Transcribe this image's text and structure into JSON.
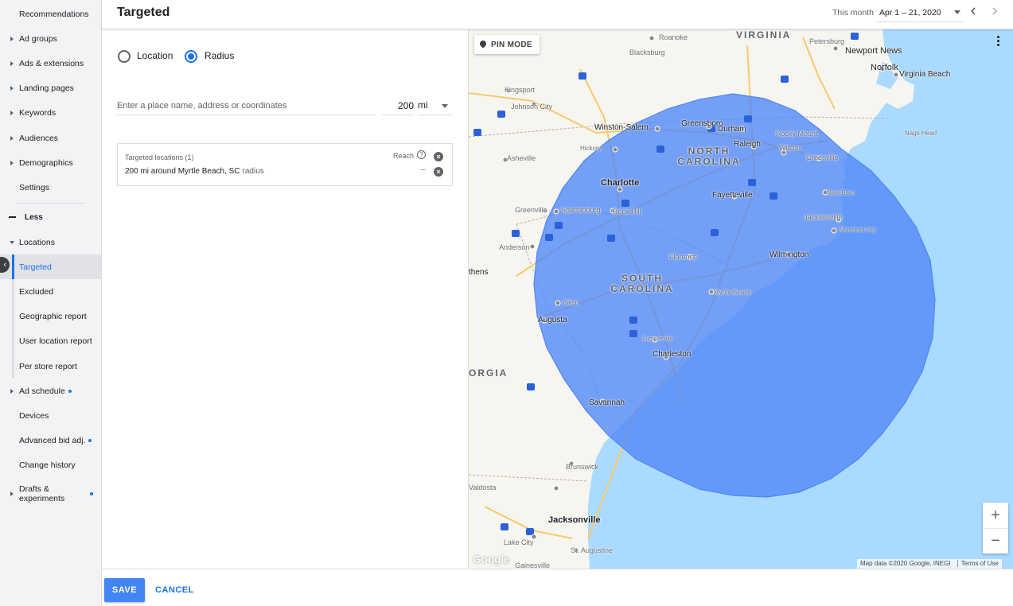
{
  "sidebar": {
    "items": [
      {
        "label": "Recommendations"
      },
      {
        "label": "Ad groups"
      },
      {
        "label": "Ads & extensions"
      },
      {
        "label": "Landing pages"
      },
      {
        "label": "Keywords"
      },
      {
        "label": "Audiences"
      },
      {
        "label": "Demographics"
      },
      {
        "label": "Settings"
      }
    ],
    "less_label": "Less",
    "locations_label": "Locations",
    "sub_items": [
      {
        "label": "Targeted",
        "active": true
      },
      {
        "label": "Excluded"
      },
      {
        "label": "Geographic report"
      },
      {
        "label": "User location report"
      },
      {
        "label": "Per store report"
      }
    ],
    "more_items": [
      {
        "label": "Ad schedule",
        "has_dot": true
      },
      {
        "label": "Devices"
      },
      {
        "label": "Advanced bid adj.",
        "has_dot": true
      },
      {
        "label": "Change history"
      },
      {
        "label": "Drafts & experiments",
        "line1": "Drafts &",
        "line2": "experiments",
        "has_dot": true
      }
    ]
  },
  "header": {
    "title": "Targeted",
    "date_range_label": "This month",
    "date_range_value": "Apr 1 – 21, 2020"
  },
  "panel": {
    "radio_location_label": "Location",
    "radio_radius_label": "Radius",
    "selected_mode": "Radius",
    "search_placeholder": "Enter a place name, address or coordinates",
    "radius_value": "200",
    "radius_unit": "mi",
    "targets": {
      "header": "Targeted locations (1)",
      "reach_label": "Reach",
      "help_glyph": "?",
      "row_text": "200 mi around Myrtle Beach, SC",
      "row_tag": "radius",
      "row_reach": "–"
    }
  },
  "map": {
    "pin_mode_label": "PIN MODE",
    "zoom_in": "+",
    "zoom_out": "−",
    "attribution": "Map data ©2020 Google, INEGI",
    "terms": "Terms of Use",
    "logo": "Google",
    "circle_color": "#4f86f7",
    "water_color": "#aadaff",
    "land_color": "#f7f5ef",
    "labels": {
      "virginia": "VIRGINIA",
      "north_carolina_1": "NORTH",
      "north_carolina_2": "CAROLINA",
      "south_carolina_1": "SOUTH",
      "south_carolina_2": "CAROLINA",
      "georgia": "ORGIA",
      "roanoke": "Roanoke",
      "blacksburg": "Blacksburg",
      "petersburg": "Petersburg",
      "newport_news": "Newport News",
      "norfolk": "Norfolk",
      "virginia_beach": "Virginia Beach",
      "kingsport": "Kingsport",
      "johnson_city": "Johnson City",
      "winston_salem": "Winston-Salem",
      "greensboro": "Greensboro",
      "durham": "Durham",
      "rocky_mount": "Rocky Mount",
      "nags_head": "Nags Head",
      "hickory": "Hickory",
      "raleigh": "Raleigh",
      "wilson": "Wilson",
      "asheville": "Asheville",
      "greenville_nc": "Greenville",
      "charlotte": "Charlotte",
      "fayetteville": "Fayetteville",
      "new_bern": "New Bern",
      "greenville_sc": "Greenville",
      "spartanburg": "Spartanburg",
      "rock_hill": "Rock Hill",
      "jacksonville_nc": "Jacksonville",
      "morehead_city": "Morehead City",
      "anderson": "Anderson",
      "athens": "thens",
      "florence": "Florence",
      "wilmington": "Wilmington",
      "myrtle_beach": "Myrtle Beach",
      "aiken": "Aiken",
      "augusta": "Augusta",
      "summerville": "Summerville",
      "charleston": "Charleston",
      "savannah": "Savannah",
      "brunswick": "Brunswick",
      "valdosta": "Valdosta",
      "jacksonville_fl": "Jacksonville",
      "lake_city": "Lake City",
      "st_augustine": "St. Augustine",
      "gainesville": "Gainesville"
    }
  },
  "footer": {
    "save_label": "SAVE",
    "cancel_label": "CANCEL"
  }
}
